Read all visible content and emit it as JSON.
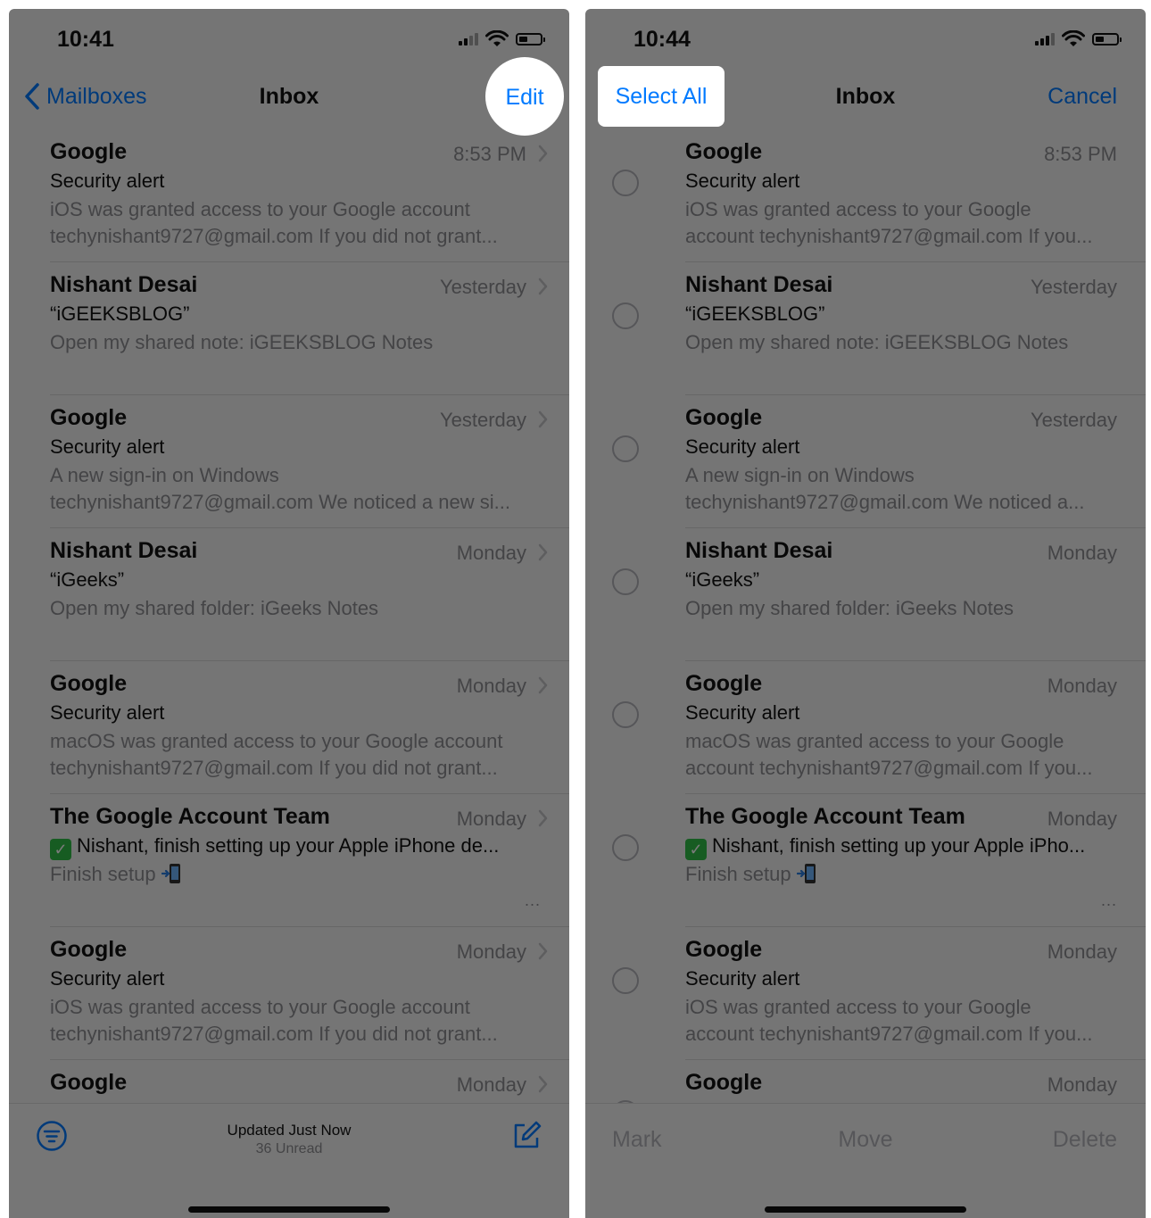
{
  "left": {
    "time": "10:41",
    "nav": {
      "back_label": "Mailboxes",
      "title": "Inbox",
      "action_label": "Edit"
    },
    "toolbar": {
      "status_line1": "Updated Just Now",
      "status_line2": "36 Unread"
    }
  },
  "right": {
    "time": "10:44",
    "nav": {
      "left_label": "Select All",
      "title": "Inbox",
      "right_label": "Cancel"
    },
    "toolbar": {
      "mark_label": "Mark",
      "move_label": "Move",
      "delete_label": "Delete"
    }
  },
  "emails_left": [
    {
      "sender": "Google",
      "date": "8:53 PM",
      "subject": "Security alert",
      "preview1": "iOS was granted access to your Google account",
      "preview2": "techynishant9727@gmail.com If you did not grant..."
    },
    {
      "sender": "Nishant Desai",
      "date": "Yesterday",
      "subject": "“iGEEKSBLOG”",
      "preview1": "Open my shared note: iGEEKSBLOG Notes",
      "preview2": ""
    },
    {
      "sender": "Google",
      "date": "Yesterday",
      "subject": "Security alert",
      "preview1": "A new sign-in on Windows",
      "preview2": "techynishant9727@gmail.com We noticed a new si..."
    },
    {
      "sender": "Nishant Desai",
      "date": "Monday",
      "subject": "“iGeeks”",
      "preview1": "Open my shared folder: iGeeks Notes",
      "preview2": ""
    },
    {
      "sender": "Google",
      "date": "Monday",
      "subject": "Security alert",
      "preview1": "macOS was granted access to your Google account",
      "preview2": "techynishant9727@gmail.com If you did not grant..."
    },
    {
      "sender": "The Google Account Team",
      "date": "Monday",
      "subject": "Nishant, finish setting up your Apple iPhone de...",
      "preview1": "Finish setup",
      "preview2": "",
      "more": "..."
    },
    {
      "sender": "Google",
      "date": "Monday",
      "subject": "Security alert",
      "preview1": "iOS was granted access to your Google account",
      "preview2": "techynishant9727@gmail.com If you did not grant..."
    },
    {
      "sender": "Google",
      "date": "Monday",
      "subject": "Security alert",
      "preview1": "",
      "preview2": ""
    }
  ],
  "emails_right": [
    {
      "sender": "Google",
      "date": "8:53 PM",
      "subject": "Security alert",
      "preview1": "iOS was granted access to your Google",
      "preview2": "account techynishant9727@gmail.com If you..."
    },
    {
      "sender": "Nishant Desai",
      "date": "Yesterday",
      "subject": "“iGEEKSBLOG”",
      "preview1": "Open my shared note: iGEEKSBLOG Notes",
      "preview2": ""
    },
    {
      "sender": "Google",
      "date": "Yesterday",
      "subject": "Security alert",
      "preview1": "A new sign-in on Windows",
      "preview2": "techynishant9727@gmail.com We noticed a..."
    },
    {
      "sender": "Nishant Desai",
      "date": "Monday",
      "subject": "“iGeeks”",
      "preview1": "Open my shared folder: iGeeks Notes",
      "preview2": ""
    },
    {
      "sender": "Google",
      "date": "Monday",
      "subject": "Security alert",
      "preview1": "macOS was granted access to your Google",
      "preview2": "account techynishant9727@gmail.com If you..."
    },
    {
      "sender": "The Google Account Team",
      "date": "Monday",
      "subject": "Nishant, finish setting up your Apple iPho...",
      "preview1": "Finish setup",
      "preview2": "",
      "more": "..."
    },
    {
      "sender": "Google",
      "date": "Monday",
      "subject": "Security alert",
      "preview1": "iOS was granted access to your Google",
      "preview2": "account techynishant9727@gmail.com If you..."
    },
    {
      "sender": "Google",
      "date": "Monday",
      "subject": "Security alert",
      "preview1": "",
      "preview2": ""
    }
  ],
  "colors": {
    "accent": "#007aff",
    "secondary_text": "#8e8e93",
    "dim_overlay": "rgba(0,0,0,0.52)"
  }
}
